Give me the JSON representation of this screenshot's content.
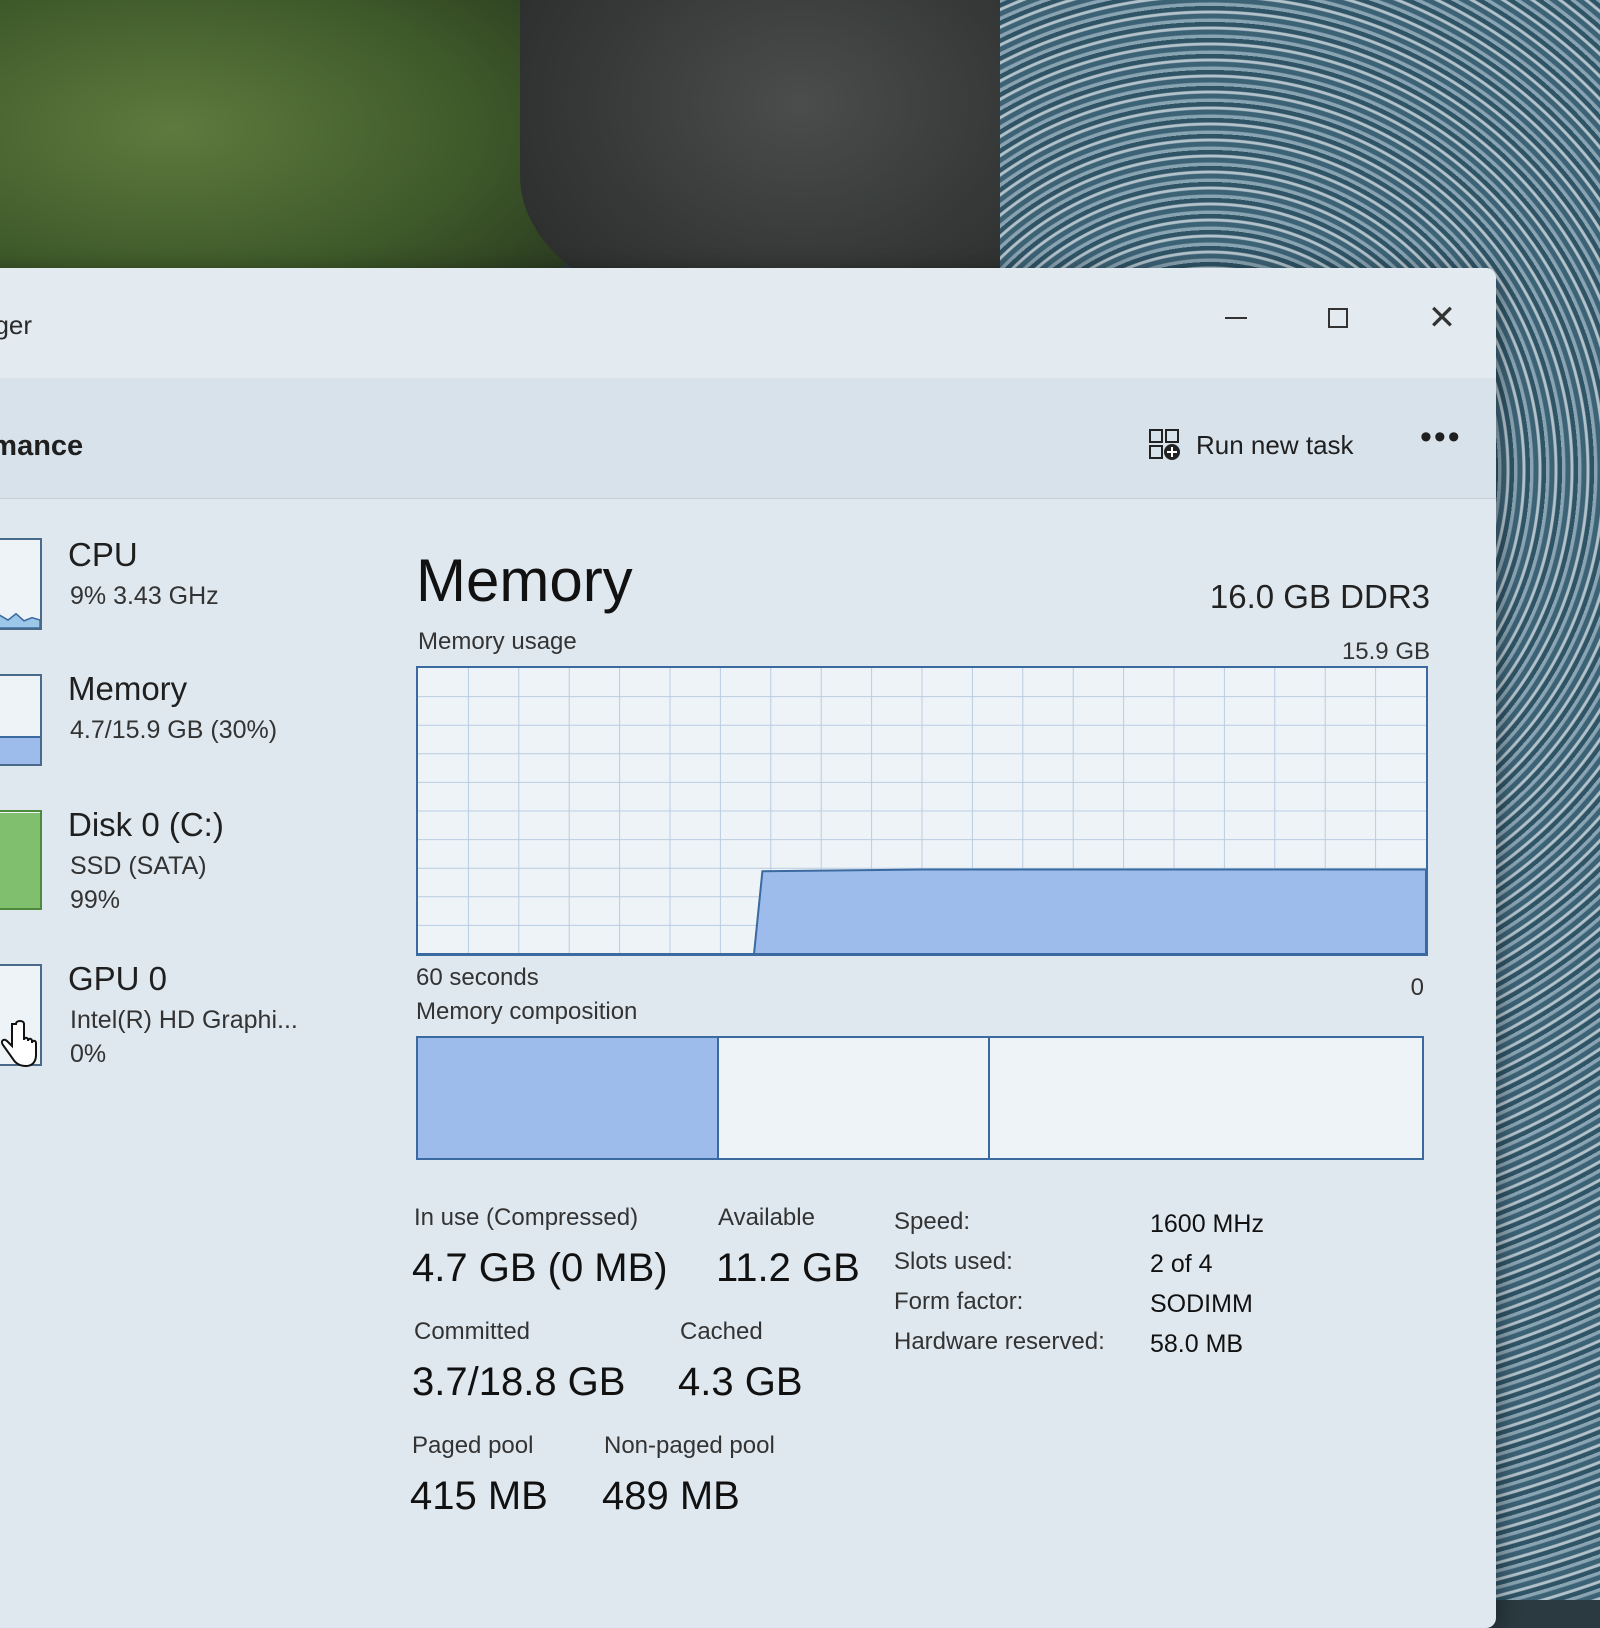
{
  "window": {
    "title": "ager",
    "section": "rmance",
    "run_new_task": "Run new task",
    "more": "•••",
    "close_glyph": "✕"
  },
  "sidebar": {
    "items": [
      {
        "name": "CPU",
        "line1": "9%  3.43 GHz",
        "line2": "",
        "fill": 0.09
      },
      {
        "name": "Memory",
        "line1": "4.7/15.9 GB (30%)",
        "line2": "",
        "fill": 0.3
      },
      {
        "name": "Disk 0 (C:)",
        "line1": "SSD (SATA)",
        "line2": "99%",
        "fill": 0.99
      },
      {
        "name": "GPU 0",
        "line1": "Intel(R) HD Graphi...",
        "line2": "0%",
        "fill": 0.0
      }
    ]
  },
  "memory": {
    "title": "Memory",
    "spec": "16.0 GB DDR3",
    "usage_label": "Memory usage",
    "usage_max": "15.9 GB",
    "time_label": "60 seconds",
    "time_end": "0",
    "composition_label": "Memory composition",
    "stats": {
      "in_use_label": "In use (Compressed)",
      "in_use_value": "4.7 GB (0 MB)",
      "available_label": "Available",
      "available_value": "11.2 GB",
      "committed_label": "Committed",
      "committed_value": "3.7/18.8 GB",
      "cached_label": "Cached",
      "cached_value": "4.3 GB",
      "paged_pool_label": "Paged pool",
      "paged_pool_value": "415 MB",
      "nonpaged_pool_label": "Non-paged pool",
      "nonpaged_pool_value": "489 MB"
    },
    "specs": {
      "speed_label": "Speed:",
      "speed_value": "1600 MHz",
      "slots_label": "Slots used:",
      "slots_value": "2 of 4",
      "form_label": "Form factor:",
      "form_value": "SODIMM",
      "hw_label": "Hardware reserved:",
      "hw_value": "58.0 MB"
    }
  },
  "colors": {
    "accent": "#3a6aa0",
    "memory_fill": "#9dbcec",
    "disk_fill": "#7fbf6e",
    "cpu_fill": "#9cc7e8"
  },
  "chart_data": {
    "type": "area",
    "title": "Memory usage",
    "x": [
      60,
      45,
      40,
      39.5,
      30,
      20,
      10,
      0
    ],
    "y": [
      0,
      0,
      0,
      4.6,
      4.7,
      4.7,
      4.7,
      4.7
    ],
    "xlabel": "60 seconds",
    "ylabel": "",
    "xlim": [
      60,
      0
    ],
    "ylim": [
      0,
      15.9
    ],
    "grid": true
  }
}
